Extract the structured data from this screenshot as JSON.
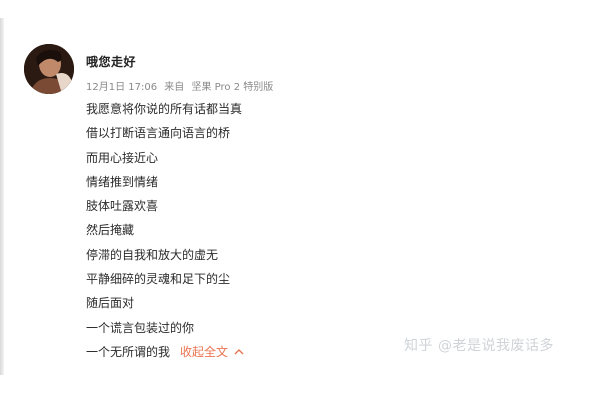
{
  "post": {
    "username": "哦您走好",
    "date": "12月1日 17:06",
    "source_prefix": "来自",
    "source_device": "坚果 Pro 2 特别版",
    "lines": [
      "我愿意将你说的所有话都当真",
      "借以打断语言通向语言的桥",
      "而用心接近心",
      "情绪推到情绪",
      "肢体吐露欢喜",
      "然后掩藏",
      "停滞的自我和放大的虚无",
      "平静细碎的灵魂和足下的尘",
      "随后面对",
      "一个谎言包装过的你",
      "一个无所谓的我"
    ],
    "collapse_label": "收起全文",
    "collapse_icon": "chevron-up-icon"
  },
  "watermark": "知乎 @老是说我废话多",
  "colors": {
    "link": "#eb7350",
    "meta": "#8a8a8a",
    "text": "#2b2b2b",
    "watermark": "#d0d4d8"
  }
}
